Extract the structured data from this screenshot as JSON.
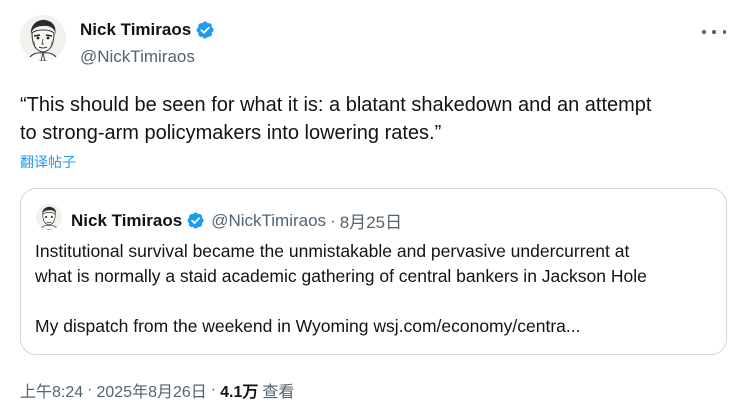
{
  "author": {
    "name": "Nick Timiraos",
    "handle": "@NickTimiraos"
  },
  "tweet": {
    "text_line1": "“This should be seen for what it is: a blatant shakedown and an attempt",
    "text_line2": "to strong-arm policymakers into lowering rates.”",
    "translate_label": "翻译帖子"
  },
  "quote": {
    "name": "Nick Timiraos",
    "handle": "@NickTimiraos",
    "separator": "·",
    "date": "8月25日",
    "line1": "Institutional survival became the unmistakable and pervasive undercurrent at",
    "line2": "what is normally a staid academic gathering of central bankers in Jackson Hole",
    "line3": "My dispatch from the weekend in Wyoming wsj.com/economy/centra..."
  },
  "meta": {
    "time": "上午8:24",
    "separator": "·",
    "date": "2025年8月26日",
    "views_count": "4.1万",
    "views_label": "查看"
  },
  "colors": {
    "text": "#0f1419",
    "secondary": "#536471",
    "link": "#1d9bf0",
    "verified": "#1d9bf0",
    "border": "#cfd9de"
  },
  "icons": {
    "verified": "verified-badge-icon",
    "more": "more-dots-icon"
  }
}
